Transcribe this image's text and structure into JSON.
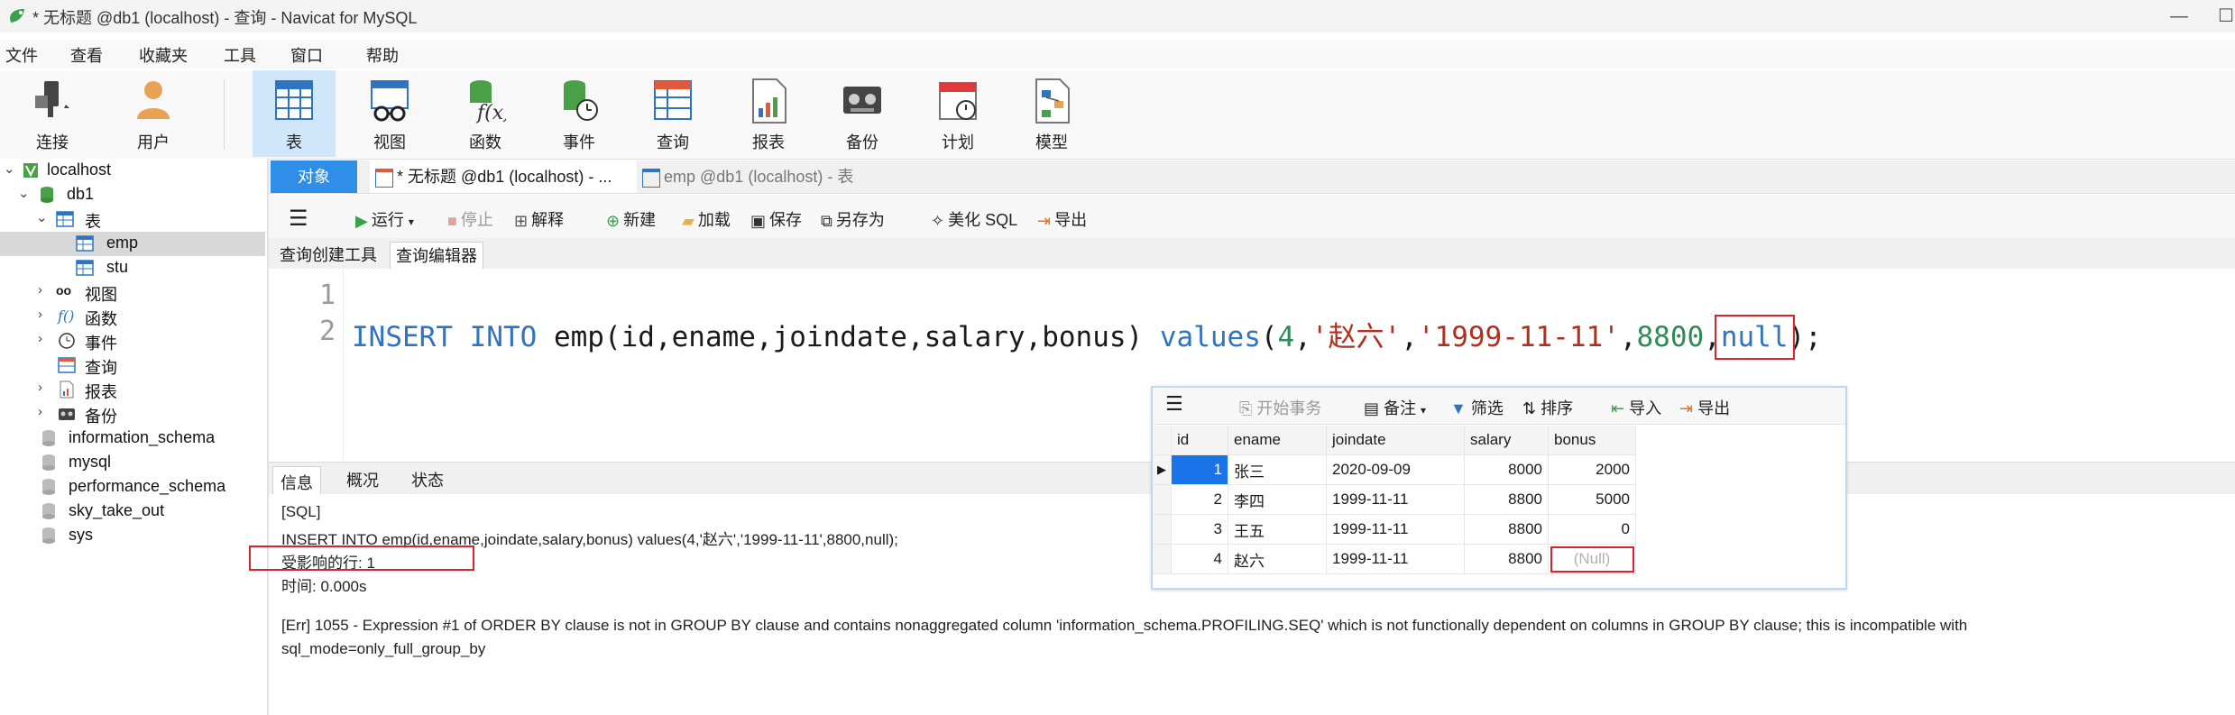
{
  "window": {
    "title": "* 无标题 @db1 (localhost) - 查询 - Navicat for MySQL",
    "minimize": "—",
    "maximize": "☐"
  },
  "menu": [
    "文件",
    "查看",
    "收藏夹",
    "工具",
    "窗口",
    "帮助"
  ],
  "toolbar": {
    "connect": "连接",
    "user": "用户",
    "table": "表",
    "view": "视图",
    "function": "函数",
    "event": "事件",
    "query": "查询",
    "report": "报表",
    "backup": "备份",
    "schedule": "计划",
    "model": "模型"
  },
  "tree": {
    "localhost": "localhost",
    "db1": "db1",
    "tables": "表",
    "emp": "emp",
    "stu": "stu",
    "views": "视图",
    "functions": "函数",
    "events": "事件",
    "queries": "查询",
    "reports": "报表",
    "backups": "备份",
    "dbs": [
      "information_schema",
      "mysql",
      "performance_schema",
      "sky_take_out",
      "sys"
    ]
  },
  "tabs": {
    "objects": "对象",
    "query_tab": "* 无标题 @db1 (localhost) - ...",
    "emp_tab": "emp @db1 (localhost) - 表"
  },
  "editor_toolbar": {
    "run": "运行",
    "stop": "停止",
    "explain": "解释",
    "new": "新建",
    "load": "加载",
    "save": "保存",
    "save_as": "另存为",
    "beautify": "美化 SQL",
    "export": "导出"
  },
  "subtabs": {
    "builder": "查询创建工具",
    "editor": "查询编辑器"
  },
  "code": {
    "line1": "1",
    "line2": "2",
    "t_insert": "INSERT INTO",
    "t_table": " emp(id,ename,joindate,salary,bonus) ",
    "t_values": "values",
    "t_open": "(",
    "t_4": "4",
    "t_comma1": ",",
    "t_name": "'赵六'",
    "t_comma2": ",",
    "t_date": "'1999-11-11'",
    "t_comma3": ",",
    "t_salary": "8800",
    "t_comma4": ",",
    "t_null": "null",
    "t_close": ");"
  },
  "info_tabs": {
    "info": "信息",
    "overview": "概况",
    "status": "状态"
  },
  "info": {
    "l1": "[SQL]",
    "l2": "INSERT INTO emp(id,ename,joindate,salary,bonus) values(4,'赵六','1999-11-11',8800,null);",
    "l3": "受影响的行: 1",
    "l4": "时间: 0.000s",
    "l5": "[Err] 1055 - Expression #1 of ORDER BY clause is not in GROUP BY clause and contains nonaggregated column 'information_schema.PROFILING.SEQ' which is not functionally dependent on columns in GROUP BY clause; this is incompatible with",
    "l6": "sql_mode=only_full_group_by"
  },
  "grid": {
    "toolbar": {
      "begin": "开始事务",
      "note": "备注",
      "filter": "筛选",
      "sort": "排序",
      "import": "导入",
      "export": "导出"
    },
    "columns": [
      "id",
      "ename",
      "joindate",
      "salary",
      "bonus"
    ],
    "rows": [
      [
        "1",
        "张三",
        "2020-09-09",
        "8000",
        "2000"
      ],
      [
        "2",
        "李四",
        "1999-11-11",
        "8800",
        "5000"
      ],
      [
        "3",
        "王五",
        "1999-11-11",
        "8800",
        "0"
      ],
      [
        "4",
        "赵六",
        "1999-11-11",
        "8800",
        "(Null)"
      ]
    ]
  },
  "colors": {
    "accent": "#2f8fe8",
    "keyword": "#2f74c0",
    "string": "#b03020",
    "number": "#2e8b57",
    "annotation": "#d9232f"
  }
}
